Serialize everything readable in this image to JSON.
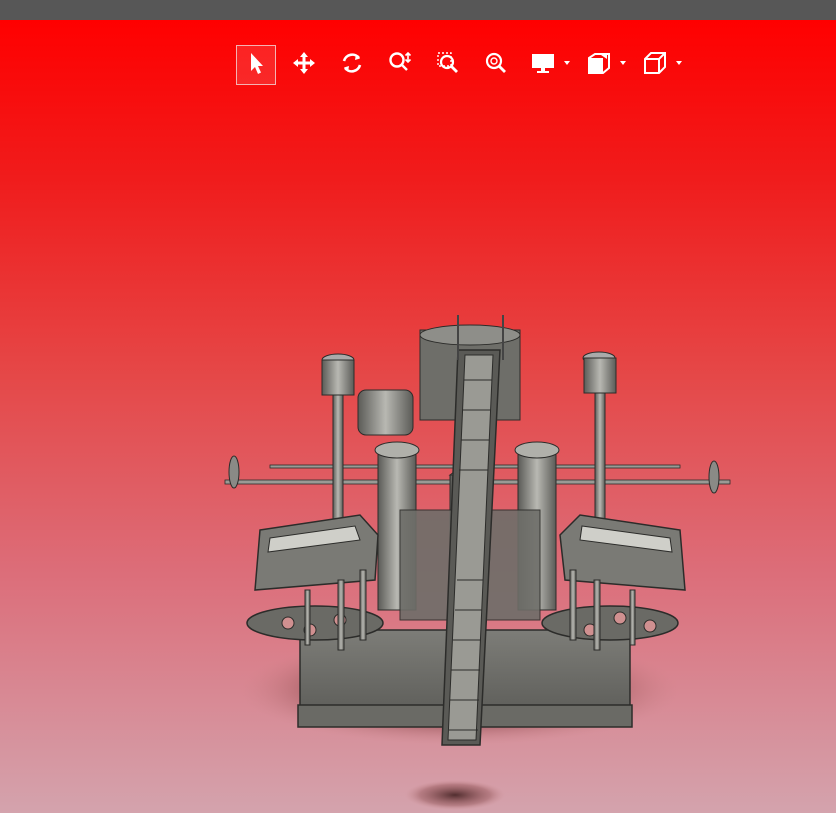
{
  "colors": {
    "topbar": "#575757",
    "viewport_top": "#ff0000",
    "viewport_bottom": "#d4a3ad",
    "icon": "#ffffff",
    "model_metal": "#8a8a86",
    "model_dark": "#3c3c3a"
  },
  "toolbar": {
    "tools": [
      {
        "id": "select",
        "icon": "pointer-icon",
        "active": true
      },
      {
        "id": "pan",
        "icon": "move-arrows-icon",
        "active": false
      },
      {
        "id": "rotate",
        "icon": "rotate-icon",
        "active": false
      },
      {
        "id": "zoom",
        "icon": "zoom-updown-icon",
        "active": false
      },
      {
        "id": "zoom-window",
        "icon": "zoom-window-icon",
        "active": false
      },
      {
        "id": "zoom-fit",
        "icon": "zoom-fit-icon",
        "active": false
      },
      {
        "id": "display",
        "icon": "monitor-icon",
        "active": false,
        "dropdown": true
      },
      {
        "id": "section",
        "icon": "section-plane-icon",
        "active": false,
        "dropdown": true
      },
      {
        "id": "view-orientation",
        "icon": "cube-view-icon",
        "active": false,
        "dropdown": true
      }
    ]
  },
  "model": {
    "description_icon": "cad-machine-model"
  }
}
